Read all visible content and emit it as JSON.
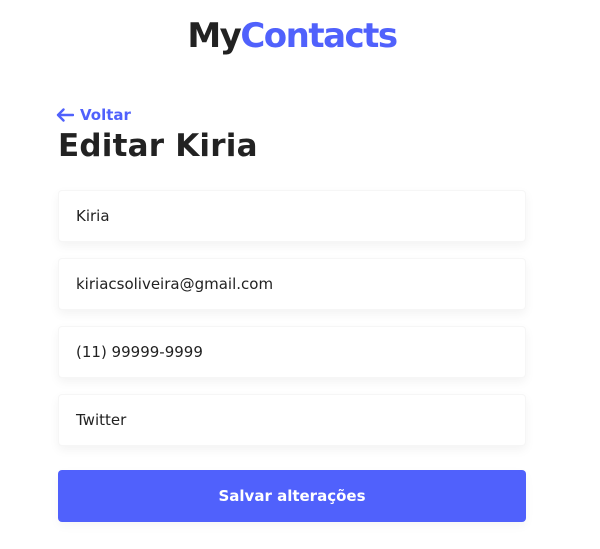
{
  "header": {
    "logo_part1": "My",
    "logo_part2": "Contacts",
    "brand_color": "#5061fc"
  },
  "nav": {
    "back_label": "Voltar",
    "back_icon": "arrow-left-icon"
  },
  "page": {
    "title": "Editar Kiria"
  },
  "form": {
    "name_value": "Kiria",
    "email_value": "kiriacsoliveira@gmail.com",
    "phone_value": "(11) 99999-9999",
    "category_value": "Twitter",
    "submit_label": "Salvar alterações"
  }
}
